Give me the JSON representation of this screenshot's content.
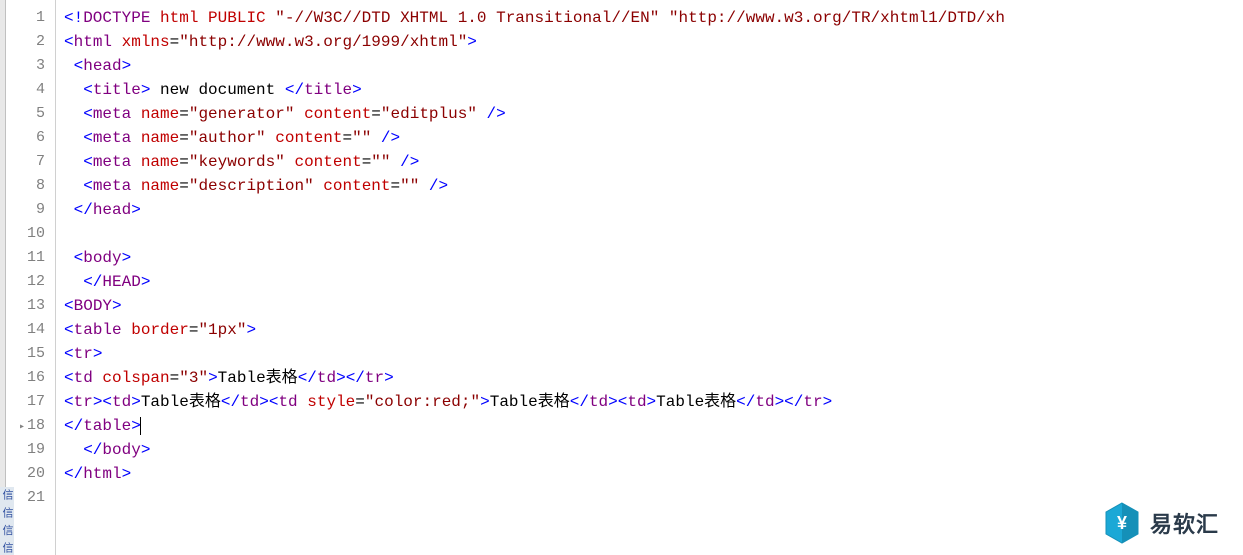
{
  "gutter": {
    "lines": [
      "1",
      "2",
      "3",
      "4",
      "5",
      "6",
      "7",
      "8",
      "9",
      "10",
      "11",
      "12",
      "13",
      "14",
      "15",
      "16",
      "17",
      "18",
      "19",
      "20",
      "21"
    ],
    "active_line_index": 17
  },
  "code": {
    "lines": [
      [
        {
          "t": "<!",
          "c": "blue"
        },
        {
          "t": "DOCTYPE",
          "c": "purple"
        },
        {
          "t": " ",
          "c": "black"
        },
        {
          "t": "html",
          "c": "red"
        },
        {
          "t": " ",
          "c": "black"
        },
        {
          "t": "PUBLIC",
          "c": "red"
        },
        {
          "t": " \"-//W3C//DTD XHTML 1.0 Transitional//EN\" \"http://www.w3.org/TR/xhtml1/DTD/xh",
          "c": "darkred"
        }
      ],
      [
        {
          "t": "<",
          "c": "blue"
        },
        {
          "t": "html",
          "c": "purple"
        },
        {
          "t": " ",
          "c": "black"
        },
        {
          "t": "xmlns",
          "c": "red"
        },
        {
          "t": "=",
          "c": "black"
        },
        {
          "t": "\"http://www.w3.org/1999/xhtml\"",
          "c": "darkred"
        },
        {
          "t": ">",
          "c": "blue"
        }
      ],
      [
        {
          "t": " ",
          "c": "black"
        },
        {
          "t": "<",
          "c": "blue"
        },
        {
          "t": "head",
          "c": "purple"
        },
        {
          "t": ">",
          "c": "blue"
        }
      ],
      [
        {
          "t": "  ",
          "c": "black"
        },
        {
          "t": "<",
          "c": "blue"
        },
        {
          "t": "title",
          "c": "purple"
        },
        {
          "t": ">",
          "c": "blue"
        },
        {
          "t": " new document ",
          "c": "black"
        },
        {
          "t": "</",
          "c": "blue"
        },
        {
          "t": "title",
          "c": "purple"
        },
        {
          "t": ">",
          "c": "blue"
        }
      ],
      [
        {
          "t": "  ",
          "c": "black"
        },
        {
          "t": "<",
          "c": "blue"
        },
        {
          "t": "meta",
          "c": "purple"
        },
        {
          "t": " ",
          "c": "black"
        },
        {
          "t": "name",
          "c": "red"
        },
        {
          "t": "=",
          "c": "black"
        },
        {
          "t": "\"generator\"",
          "c": "darkred"
        },
        {
          "t": " ",
          "c": "black"
        },
        {
          "t": "content",
          "c": "red"
        },
        {
          "t": "=",
          "c": "black"
        },
        {
          "t": "\"editplus\"",
          "c": "darkred"
        },
        {
          "t": " ",
          "c": "black"
        },
        {
          "t": "/>",
          "c": "blue"
        }
      ],
      [
        {
          "t": "  ",
          "c": "black"
        },
        {
          "t": "<",
          "c": "blue"
        },
        {
          "t": "meta",
          "c": "purple"
        },
        {
          "t": " ",
          "c": "black"
        },
        {
          "t": "name",
          "c": "red"
        },
        {
          "t": "=",
          "c": "black"
        },
        {
          "t": "\"author\"",
          "c": "darkred"
        },
        {
          "t": " ",
          "c": "black"
        },
        {
          "t": "content",
          "c": "red"
        },
        {
          "t": "=",
          "c": "black"
        },
        {
          "t": "\"\"",
          "c": "darkred"
        },
        {
          "t": " ",
          "c": "black"
        },
        {
          "t": "/>",
          "c": "blue"
        }
      ],
      [
        {
          "t": "  ",
          "c": "black"
        },
        {
          "t": "<",
          "c": "blue"
        },
        {
          "t": "meta",
          "c": "purple"
        },
        {
          "t": " ",
          "c": "black"
        },
        {
          "t": "name",
          "c": "red"
        },
        {
          "t": "=",
          "c": "black"
        },
        {
          "t": "\"keywords\"",
          "c": "darkred"
        },
        {
          "t": " ",
          "c": "black"
        },
        {
          "t": "content",
          "c": "red"
        },
        {
          "t": "=",
          "c": "black"
        },
        {
          "t": "\"\"",
          "c": "darkred"
        },
        {
          "t": " ",
          "c": "black"
        },
        {
          "t": "/>",
          "c": "blue"
        }
      ],
      [
        {
          "t": "  ",
          "c": "black"
        },
        {
          "t": "<",
          "c": "blue"
        },
        {
          "t": "meta",
          "c": "purple"
        },
        {
          "t": " ",
          "c": "black"
        },
        {
          "t": "name",
          "c": "red"
        },
        {
          "t": "=",
          "c": "black"
        },
        {
          "t": "\"description\"",
          "c": "darkred"
        },
        {
          "t": " ",
          "c": "black"
        },
        {
          "t": "content",
          "c": "red"
        },
        {
          "t": "=",
          "c": "black"
        },
        {
          "t": "\"\"",
          "c": "darkred"
        },
        {
          "t": " ",
          "c": "black"
        },
        {
          "t": "/>",
          "c": "blue"
        }
      ],
      [
        {
          "t": " ",
          "c": "black"
        },
        {
          "t": "</",
          "c": "blue"
        },
        {
          "t": "head",
          "c": "purple"
        },
        {
          "t": ">",
          "c": "blue"
        }
      ],
      [],
      [
        {
          "t": " ",
          "c": "black"
        },
        {
          "t": "<",
          "c": "blue"
        },
        {
          "t": "body",
          "c": "purple"
        },
        {
          "t": ">",
          "c": "blue"
        }
      ],
      [
        {
          "t": "  ",
          "c": "black"
        },
        {
          "t": "</",
          "c": "blue"
        },
        {
          "t": "HEAD",
          "c": "purple"
        },
        {
          "t": ">",
          "c": "blue"
        }
      ],
      [
        {
          "t": "<",
          "c": "blue"
        },
        {
          "t": "BODY",
          "c": "purple"
        },
        {
          "t": ">",
          "c": "blue"
        }
      ],
      [
        {
          "t": "<",
          "c": "blue"
        },
        {
          "t": "table",
          "c": "purple"
        },
        {
          "t": " ",
          "c": "black"
        },
        {
          "t": "border",
          "c": "red"
        },
        {
          "t": "=",
          "c": "black"
        },
        {
          "t": "\"1px\"",
          "c": "darkred"
        },
        {
          "t": ">",
          "c": "blue"
        }
      ],
      [
        {
          "t": "<",
          "c": "blue"
        },
        {
          "t": "tr",
          "c": "purple"
        },
        {
          "t": ">",
          "c": "blue"
        }
      ],
      [
        {
          "t": "<",
          "c": "blue"
        },
        {
          "t": "td",
          "c": "purple"
        },
        {
          "t": " ",
          "c": "black"
        },
        {
          "t": "colspan",
          "c": "red"
        },
        {
          "t": "=",
          "c": "black"
        },
        {
          "t": "\"3\"",
          "c": "darkred"
        },
        {
          "t": ">",
          "c": "blue"
        },
        {
          "t": "Table表格",
          "c": "black"
        },
        {
          "t": "</",
          "c": "blue"
        },
        {
          "t": "td",
          "c": "purple"
        },
        {
          "t": "></",
          "c": "blue"
        },
        {
          "t": "tr",
          "c": "purple"
        },
        {
          "t": ">",
          "c": "blue"
        }
      ],
      [
        {
          "t": "<",
          "c": "blue"
        },
        {
          "t": "tr",
          "c": "purple"
        },
        {
          "t": "><",
          "c": "blue"
        },
        {
          "t": "td",
          "c": "purple"
        },
        {
          "t": ">",
          "c": "blue"
        },
        {
          "t": "Table表格",
          "c": "black"
        },
        {
          "t": "</",
          "c": "blue"
        },
        {
          "t": "td",
          "c": "purple"
        },
        {
          "t": "><",
          "c": "blue"
        },
        {
          "t": "td",
          "c": "purple"
        },
        {
          "t": " ",
          "c": "black"
        },
        {
          "t": "style",
          "c": "red"
        },
        {
          "t": "=",
          "c": "black"
        },
        {
          "t": "\"color:red;\"",
          "c": "darkred"
        },
        {
          "t": ">",
          "c": "blue"
        },
        {
          "t": "Table表格",
          "c": "black"
        },
        {
          "t": "</",
          "c": "blue"
        },
        {
          "t": "td",
          "c": "purple"
        },
        {
          "t": "><",
          "c": "blue"
        },
        {
          "t": "td",
          "c": "purple"
        },
        {
          "t": ">",
          "c": "blue"
        },
        {
          "t": "Table表格",
          "c": "black"
        },
        {
          "t": "</",
          "c": "blue"
        },
        {
          "t": "td",
          "c": "purple"
        },
        {
          "t": "></",
          "c": "blue"
        },
        {
          "t": "tr",
          "c": "purple"
        },
        {
          "t": ">",
          "c": "blue"
        }
      ],
      [
        {
          "t": "</",
          "c": "blue"
        },
        {
          "t": "table",
          "c": "purple"
        },
        {
          "t": ">",
          "c": "blue"
        },
        {
          "t": "|",
          "c": "black",
          "cursor": true
        }
      ],
      [
        {
          "t": "  ",
          "c": "black"
        },
        {
          "t": "</",
          "c": "blue"
        },
        {
          "t": "body",
          "c": "purple"
        },
        {
          "t": ">",
          "c": "blue"
        }
      ],
      [
        {
          "t": "</",
          "c": "blue"
        },
        {
          "t": "html",
          "c": "purple"
        },
        {
          "t": ">",
          "c": "blue"
        }
      ],
      []
    ]
  },
  "side_tabs": [
    "信",
    "信",
    "信",
    "信"
  ],
  "watermark": {
    "text": "易软汇"
  }
}
